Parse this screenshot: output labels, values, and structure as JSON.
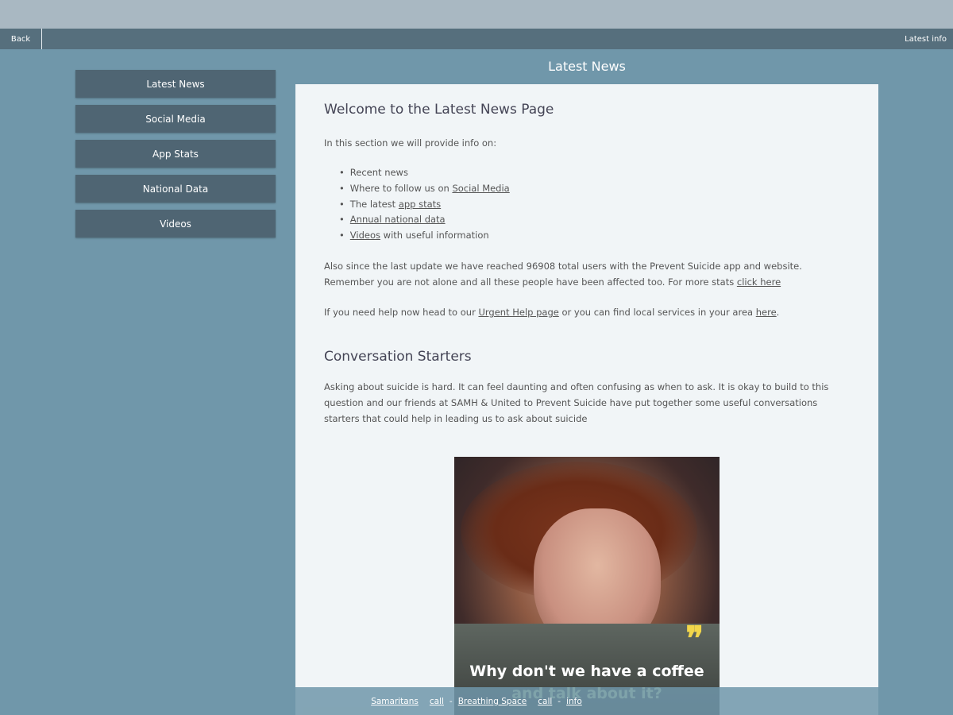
{
  "nav": {
    "back_label": "Back",
    "info_label": "Latest info"
  },
  "page_title": "Latest News",
  "sidebar": {
    "items": [
      {
        "label": "Latest News"
      },
      {
        "label": "Social Media"
      },
      {
        "label": "App Stats"
      },
      {
        "label": "National Data"
      },
      {
        "label": "Videos"
      }
    ]
  },
  "content": {
    "heading1": "Welcome to the Latest News Page",
    "intro": "In this section we will provide info on:",
    "bullets": {
      "recent": "Recent news",
      "follow_prefix": "Where to follow us on ",
      "follow_link": "Social Media",
      "stats_prefix": "The latest ",
      "stats_link": "app stats",
      "national_link": "Annual national data",
      "videos_link": "Videos",
      "videos_suffix": " with useful information"
    },
    "users_text": "Also since the last update we have reached 96908 total users with the Prevent Suicide app and website. Remember you are not alone and all these people have been affected too. For more stats ",
    "users_link": "click here",
    "help_prefix": "If you need help now head to our ",
    "help_link": "Urgent Help page",
    "help_middle": " or you can find local services in your area ",
    "help_link2": "here",
    "help_suffix": ".",
    "heading2": "Conversation Starters",
    "starters_text": "Asking about suicide is hard. It can feel daunting and often confusing as when to ask. It is okay to build to this question and our friends at SAMH & United to Prevent Suicide have put together some useful conversations starters that could help in leading us to ask about suicide",
    "image_caption_line1": "Why don't we have a coffee",
    "image_caption_line2": "and talk about it?"
  },
  "footer": {
    "samaritans": "Samaritans",
    "call1": "call",
    "sep1": "-",
    "breathing_space": "Breathing Space",
    "call2": "call",
    "sep2": "-",
    "info": "info"
  },
  "colors": {
    "background": "#7097aa",
    "nav_bar": "#566f7d",
    "menu_button": "#4f6573",
    "panel": "#f1f5f7",
    "quote_mark": "#f2d64a"
  }
}
